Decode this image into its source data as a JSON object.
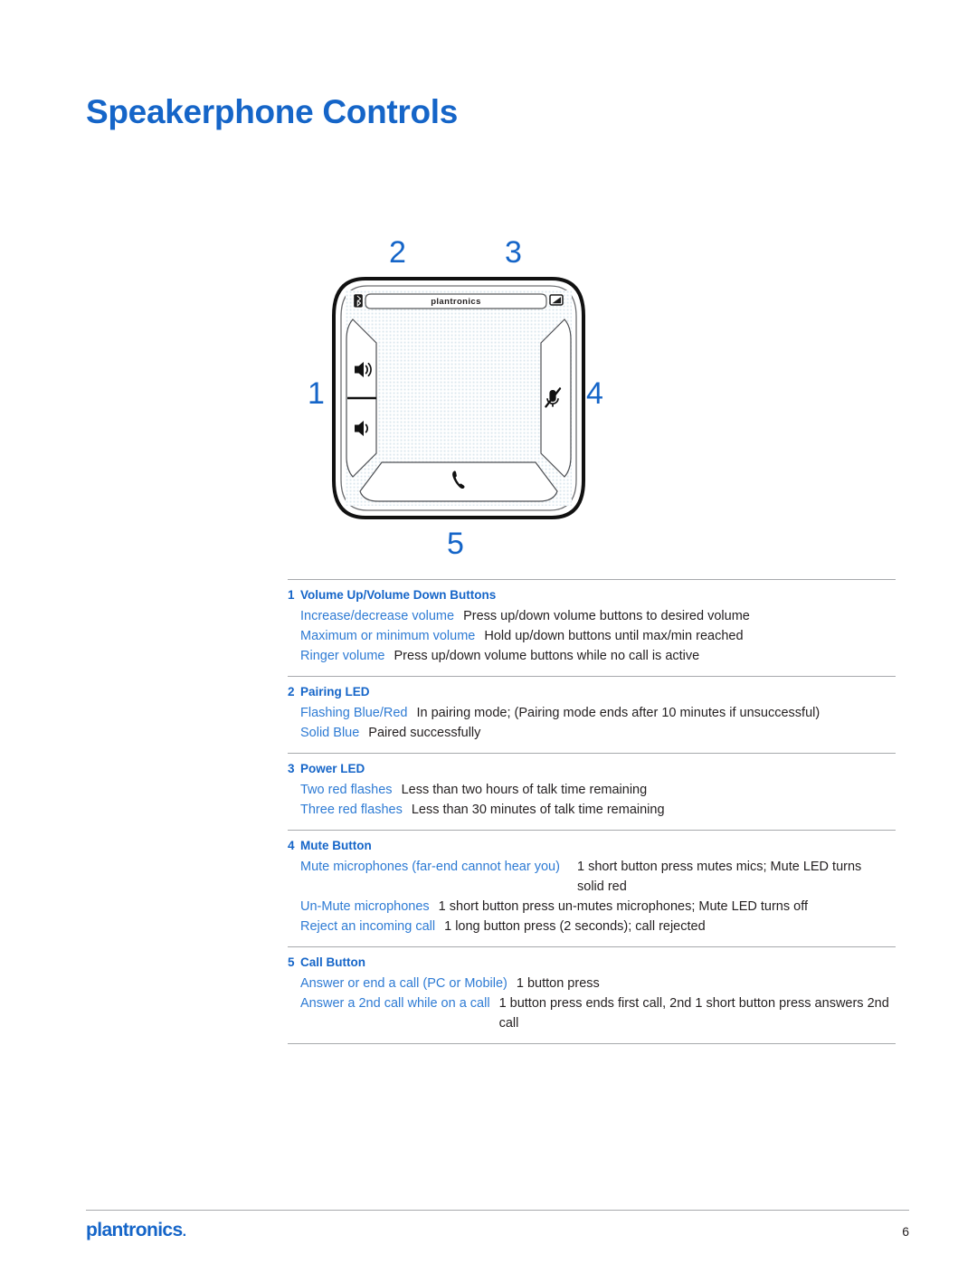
{
  "document": {
    "title": "Speakerphone Controls",
    "page_number": "6",
    "brand": "plantronics",
    "brand_mark": "."
  },
  "figure": {
    "name": "plantronics-speakerphone-top-view",
    "device_logo": "plantronics",
    "callouts": [
      {
        "number": "1",
        "target": "volume-buttons"
      },
      {
        "number": "2",
        "target": "pairing-led"
      },
      {
        "number": "3",
        "target": "power-led"
      },
      {
        "number": "4",
        "target": "mute-button"
      },
      {
        "number": "5",
        "target": "call-button"
      }
    ],
    "icons": [
      "bluetooth-icon",
      "battery-icon",
      "volume-up-icon",
      "volume-down-icon",
      "mute-microphone-icon",
      "call-handset-icon"
    ]
  },
  "spec_groups": [
    {
      "number": "1",
      "title": "Volume Up/Volume Down Buttons",
      "layout": "inline",
      "rows": [
        {
          "label": "Increase/decrease volume",
          "desc": "Press up/down volume buttons to desired volume"
        },
        {
          "label": "Maximum or minimum volume",
          "desc": "Hold up/down buttons until max/min reached"
        },
        {
          "label": "Ringer volume",
          "desc": "Press up/down volume buttons while no call is active"
        }
      ]
    },
    {
      "number": "2",
      "title": "Pairing LED",
      "layout": "inline",
      "rows": [
        {
          "label": "Flashing Blue/Red",
          "desc": "In pairing mode; (Pairing mode ends after 10 minutes if unsuccessful)"
        },
        {
          "label": "Solid Blue",
          "desc": "Paired successfully"
        }
      ]
    },
    {
      "number": "3",
      "title": "Power LED",
      "layout": "inline",
      "rows": [
        {
          "label": "Two red flashes",
          "desc": "Less than two hours of talk time remaining"
        },
        {
          "label": "Three red flashes",
          "desc": "Less than 30 minutes of talk time remaining"
        }
      ]
    },
    {
      "number": "4",
      "title": "Mute Button",
      "layout": "mixed",
      "rows": [
        {
          "label": "Mute microphones (far-end cannot hear you)",
          "desc": "1 short button press mutes mics; Mute LED turns solid red",
          "columns": true
        },
        {
          "label": "Un-Mute microphones",
          "desc": "1 short button press un-mutes microphones; Mute LED turns off"
        },
        {
          "label": "Reject an incoming call",
          "desc": "1 long button press (2 seconds); call rejected"
        }
      ]
    },
    {
      "number": "5",
      "title": "Call Button",
      "layout": "inline",
      "rows": [
        {
          "label": "Answer or end a call (PC or Mobile)",
          "desc": "1 button press"
        },
        {
          "label": "Answer a 2nd call while on a call",
          "desc": "1 button press ends first call, 2nd 1 short button press answers 2nd call",
          "hang": true
        }
      ]
    }
  ],
  "colors": {
    "brand_blue": "#1565c8",
    "label_blue": "#2e7bd4",
    "body_text": "#231f20",
    "rule_gray": "#a7a9ac",
    "grille": "#dfe8ef"
  }
}
